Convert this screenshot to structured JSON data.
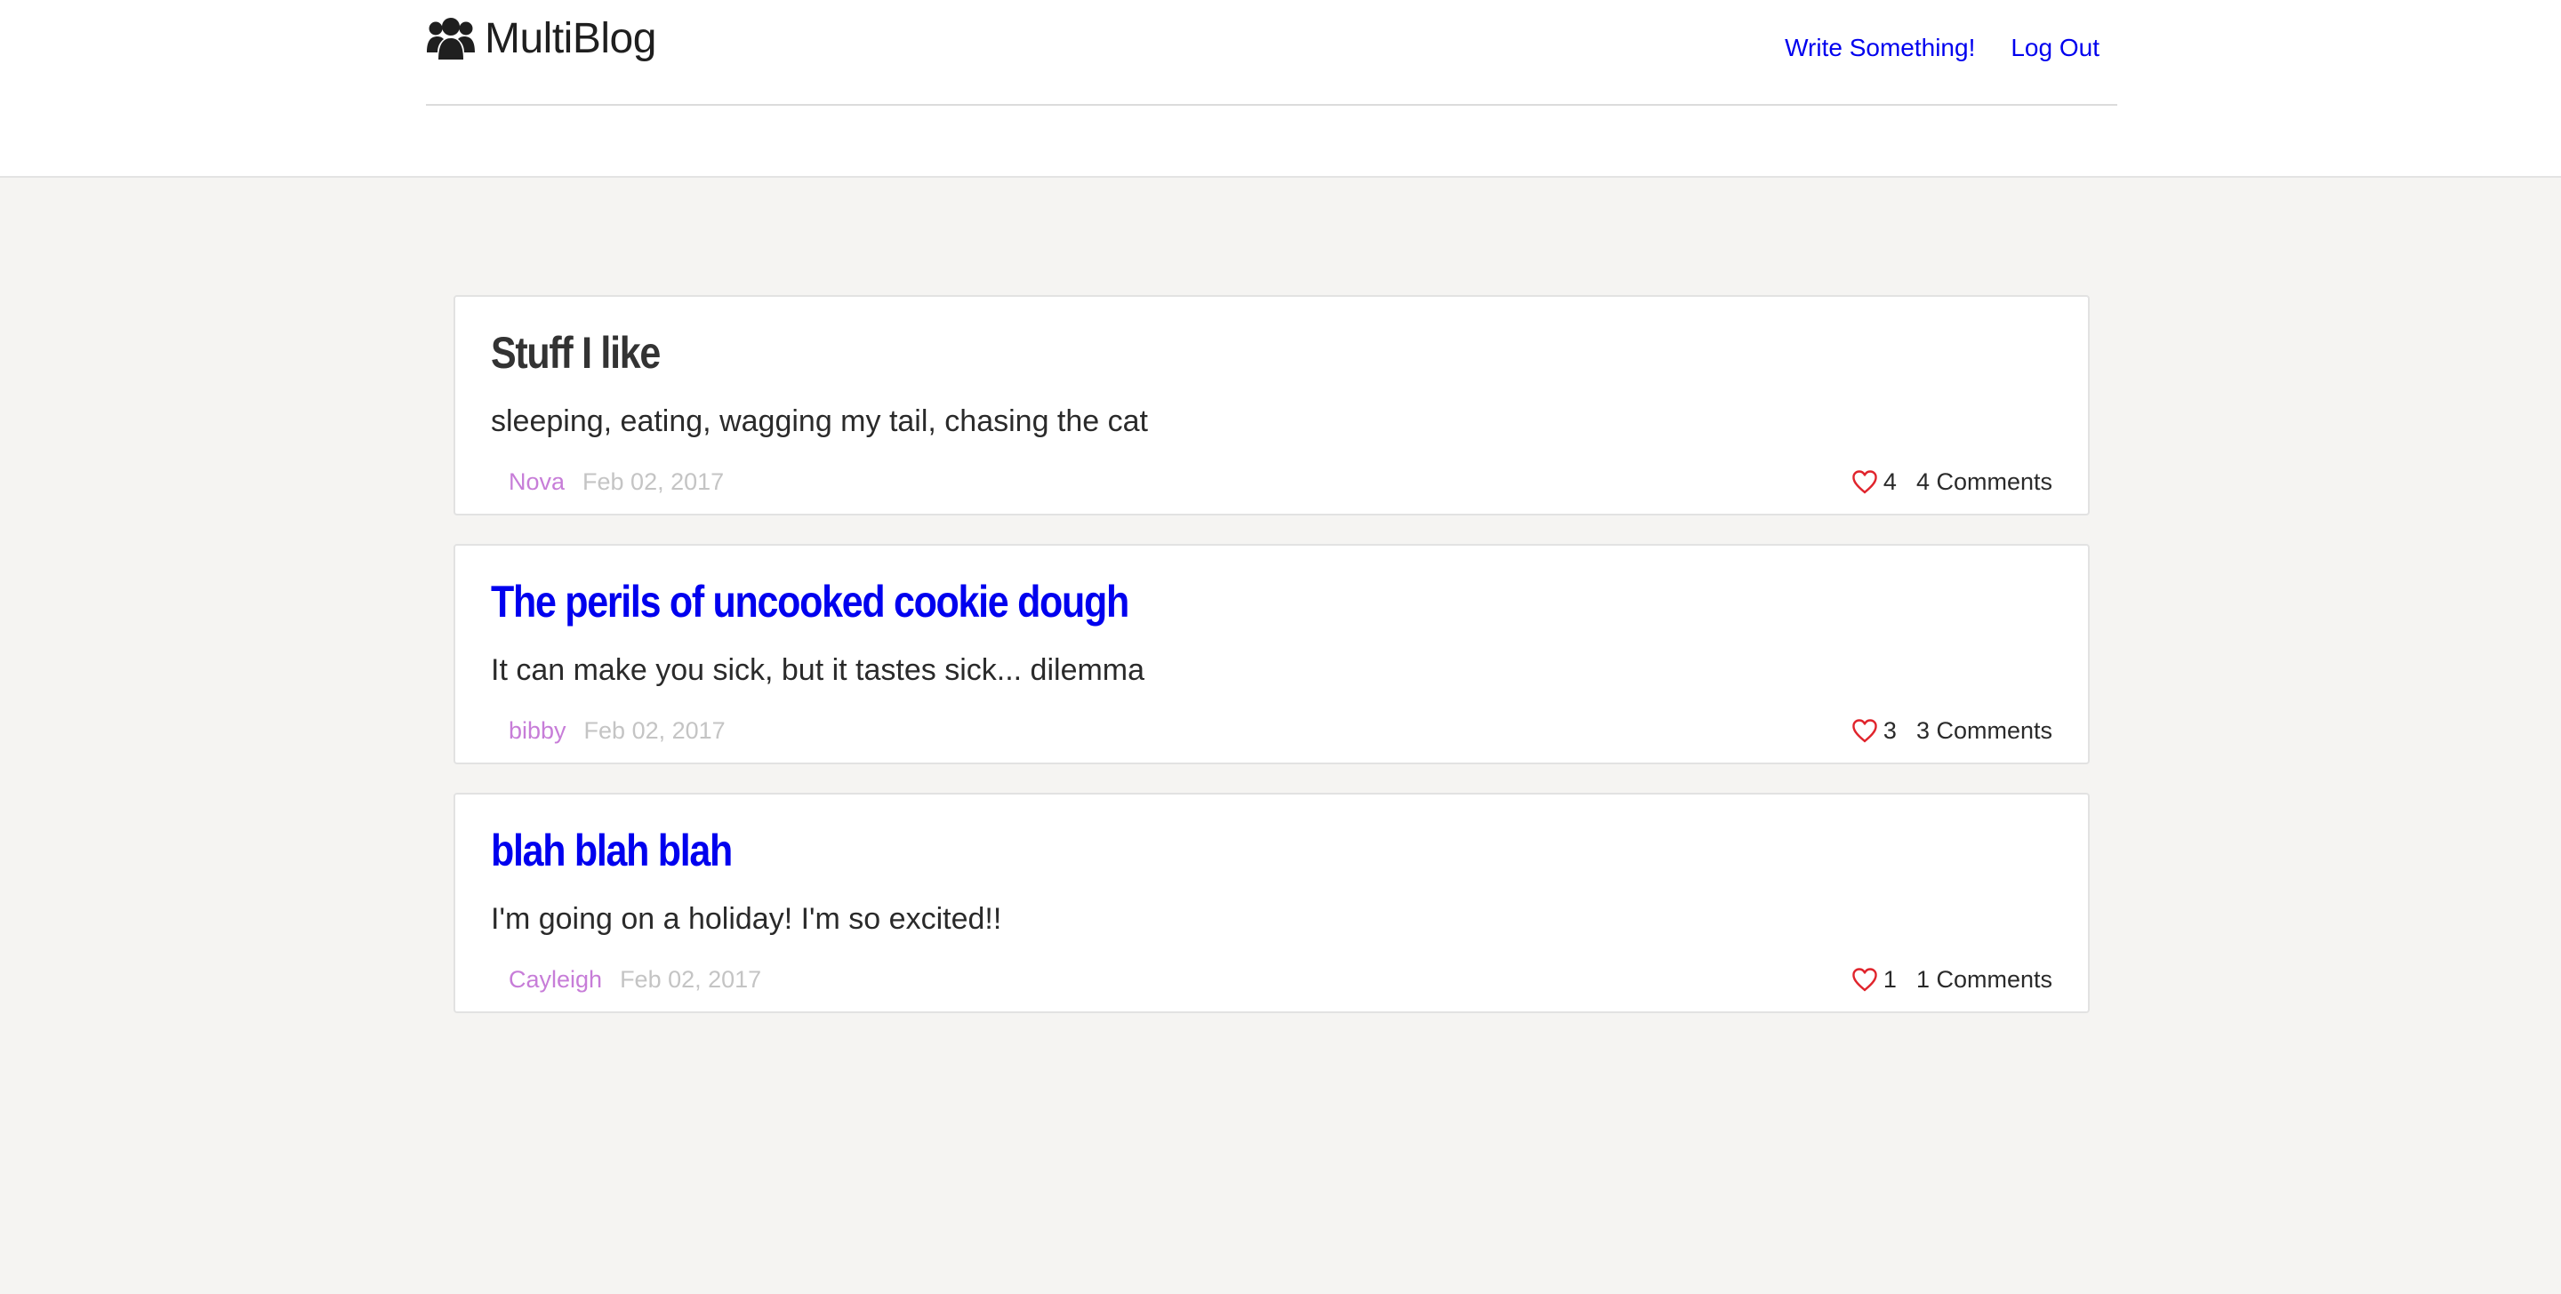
{
  "header": {
    "brand": "MultiBlog",
    "brand_icon": "users-icon",
    "nav": {
      "write_label": "Write Something!",
      "logout_label": "Log Out"
    },
    "link_color": "#0000ee"
  },
  "posts": [
    {
      "title": "Stuff I like",
      "title_is_link": false,
      "body": "sleeping, eating, wagging my tail, chasing the cat",
      "author": "Nova",
      "date": "Feb 02, 2017",
      "likes": "4",
      "comments": "4 Comments"
    },
    {
      "title": "The perils of uncooked cookie dough",
      "title_is_link": true,
      "body": "It can make you sick, but it tastes sick... dilemma",
      "author": "bibby",
      "date": "Feb 02, 2017",
      "likes": "3",
      "comments": "3 Comments"
    },
    {
      "title": "blah blah blah",
      "title_is_link": true,
      "body": "I'm going on a holiday! I'm so excited!!",
      "author": "Cayleigh",
      "date": "Feb 02, 2017",
      "likes": "1",
      "comments": "1 Comments"
    }
  ],
  "colors": {
    "author": "#c77dd8",
    "date": "#c4c4c4",
    "heart": "#e0242c",
    "background": "#f5f4f2"
  }
}
